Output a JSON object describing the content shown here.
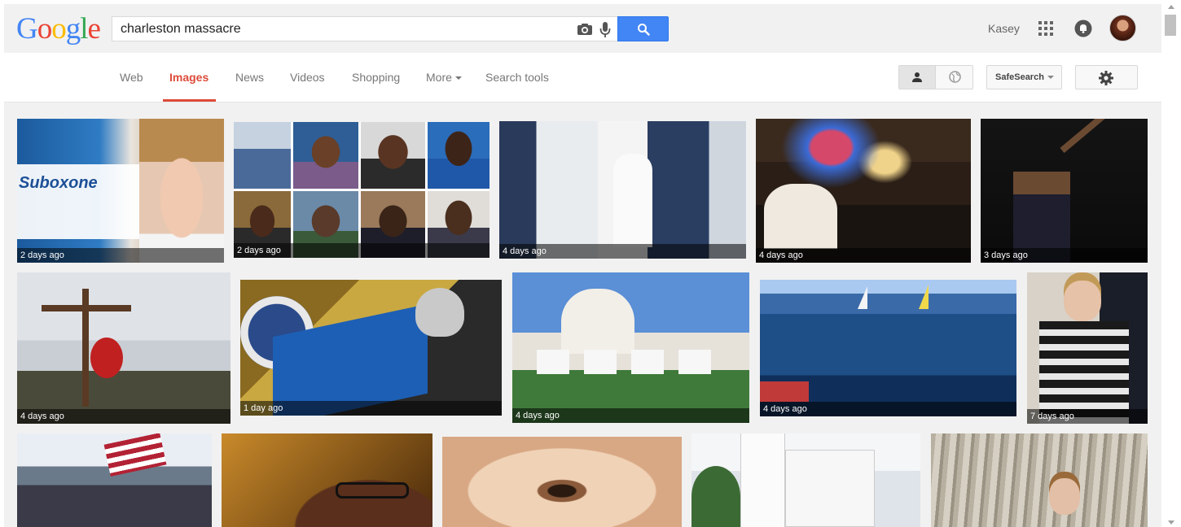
{
  "logo": {
    "letters": [
      "G",
      "o",
      "o",
      "g",
      "l",
      "e"
    ],
    "colors": [
      "#4285f4",
      "#ea4335",
      "#fbbc05",
      "#4285f4",
      "#34a853",
      "#ea4335"
    ]
  },
  "search": {
    "query": "charleston massacre",
    "camera_icon": "camera-icon",
    "mic_icon": "microphone-icon",
    "button_icon": "search-icon",
    "accent": "#4285f4"
  },
  "account": {
    "name": "Kasey",
    "apps_icon": "apps-grid-icon",
    "notifications_icon": "notifications-icon"
  },
  "tabs": [
    {
      "label": "Web",
      "active": false
    },
    {
      "label": "Images",
      "active": true
    },
    {
      "label": "News",
      "active": false
    },
    {
      "label": "Videos",
      "active": false
    },
    {
      "label": "Shopping",
      "active": false
    },
    {
      "label": "More",
      "active": false
    },
    {
      "label": "Search tools",
      "active": false
    }
  ],
  "active_color": "#dd4b39",
  "tools": {
    "safesearch_label": "SafeSearch",
    "view_person_icon": "person-icon",
    "view_globe_icon": "globe-icon",
    "settings_icon": "gear-icon"
  },
  "results": [
    {
      "caption": "2 days ago",
      "subject": "Suboxone box ad with young man"
    },
    {
      "caption": "2 days ago",
      "subject": "Collage of eight victims portraits"
    },
    {
      "caption": "4 days ago",
      "subject": "Wedding outside white church"
    },
    {
      "caption": "4 days ago",
      "subject": "Women praying in church"
    },
    {
      "caption": "3 days ago",
      "subject": "Man pointing upward in dark"
    },
    {
      "caption": "4 days ago",
      "subject": "Wooden cross and memorial flowers"
    },
    {
      "caption": "1 day ago",
      "subject": "Senator at Senate podium"
    },
    {
      "caption": "4 days ago",
      "subject": "Protesters at state house"
    },
    {
      "caption": "4 days ago",
      "subject": "Sailboats on harbor water"
    },
    {
      "caption": "7 days ago",
      "subject": "Suspect escorted by officer"
    },
    {
      "caption": "",
      "subject": "Crowd with American flag"
    },
    {
      "caption": "",
      "subject": "Woman praying with raised hand"
    },
    {
      "caption": "",
      "subject": "Close-up of child eye"
    },
    {
      "caption": "",
      "subject": "White church steeple"
    },
    {
      "caption": "",
      "subject": "Young man among mossy trees"
    }
  ]
}
